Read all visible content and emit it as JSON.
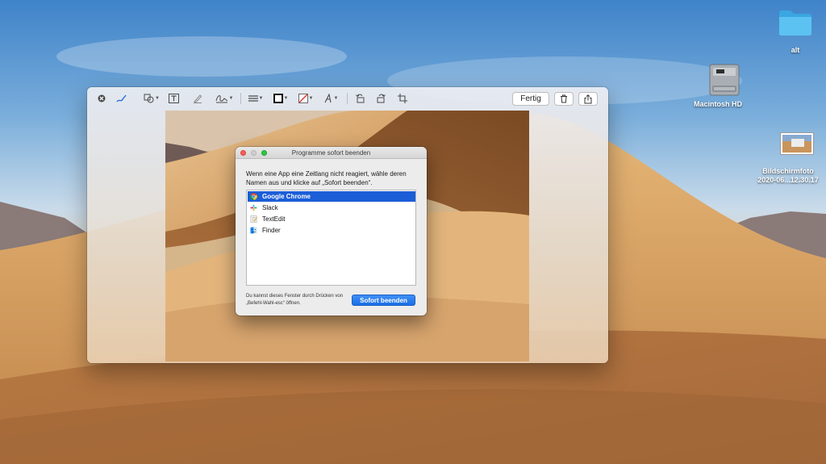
{
  "desktop": {
    "icons": [
      {
        "label": "alt",
        "kind": "folder-icon"
      },
      {
        "label": "Macintosh HD",
        "kind": "hard-drive-icon"
      },
      {
        "label_line1": "Bildschirmfoto",
        "label_line2": "2020-06...12.30.17",
        "kind": "screenshot-thumbnail-icon"
      }
    ]
  },
  "markup_toolbar": {
    "done_label": "Fertig",
    "tools": [
      "close-icon",
      "sketch-icon",
      "shapes-icon",
      "text-box-icon",
      "highlight-icon",
      "signature-icon",
      "line-style-icon",
      "border-color-icon",
      "fill-color-icon",
      "font-icon",
      "rotate-left-icon",
      "rotate-right-icon",
      "crop-icon",
      "trash-icon",
      "share-icon"
    ]
  },
  "force_quit": {
    "title": "Programme sofort beenden",
    "instruction": "Wenn eine App eine Zeitlang nicht reagiert, wähle deren Namen aus und klicke auf „Sofort beenden“.",
    "apps": [
      {
        "name": "Google Chrome",
        "selected": true,
        "icon": "chrome-icon"
      },
      {
        "name": "Slack",
        "selected": false,
        "icon": "slack-icon"
      },
      {
        "name": "TextEdit",
        "selected": false,
        "icon": "textedit-icon"
      },
      {
        "name": "Finder",
        "selected": false,
        "icon": "finder-icon"
      }
    ],
    "hint": "Du kannst dieses Fenster durch Drücken von „Befehl-Wahl-esc“ öffnen.",
    "button_label": "Sofort beenden"
  },
  "colors": {
    "selection": "#1b5ed8",
    "accent_button": "#2a7ef0",
    "folder": "#4fb7ee"
  }
}
